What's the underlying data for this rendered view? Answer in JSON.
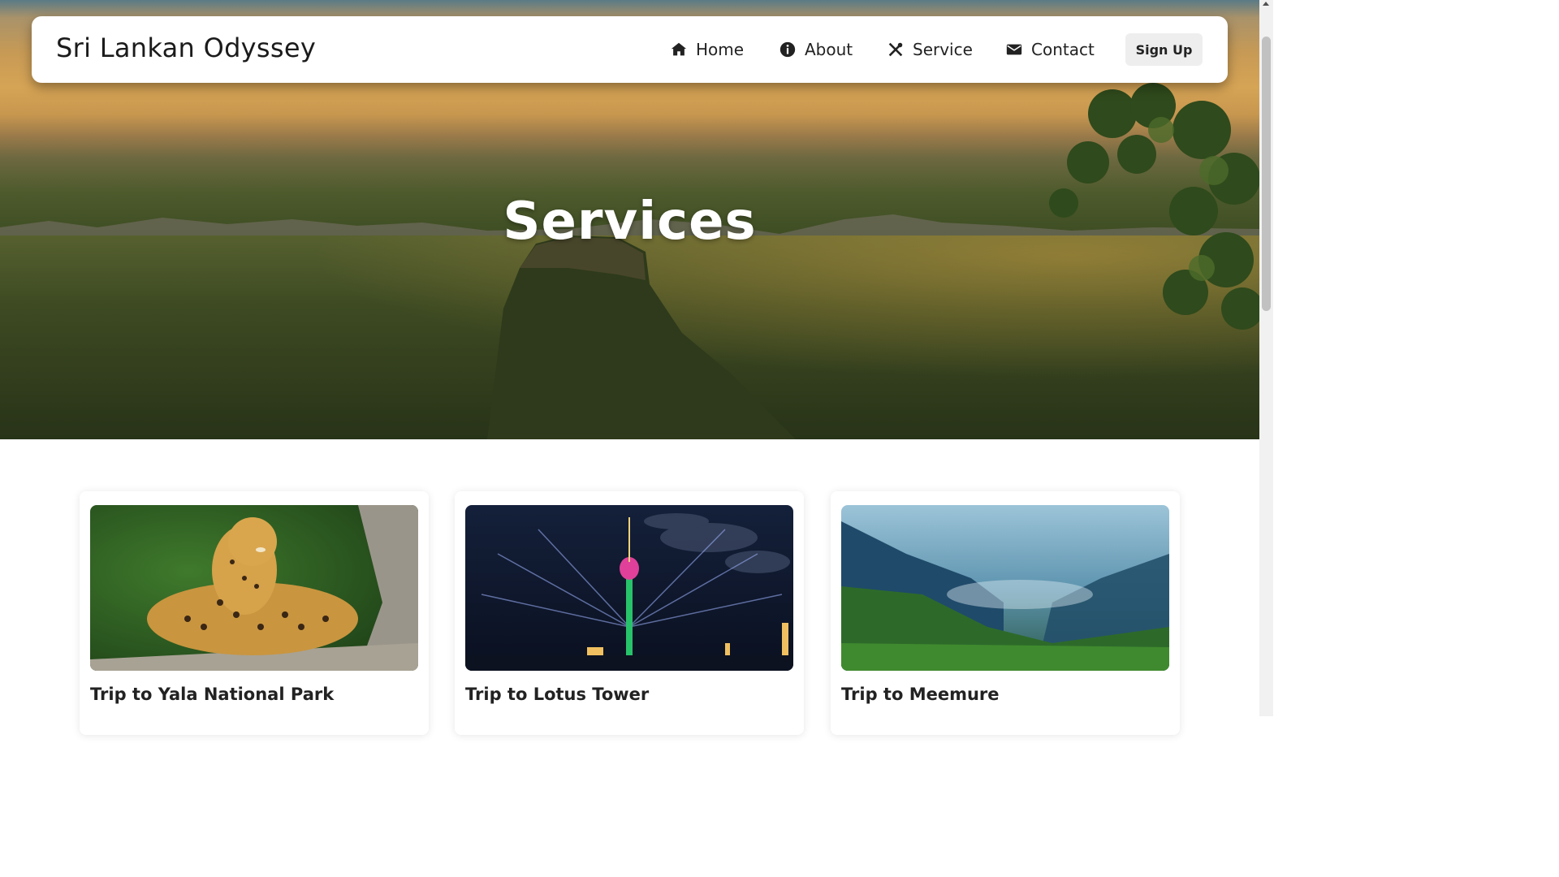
{
  "brand": {
    "name": "Sri Lankan Odyssey"
  },
  "nav": {
    "items": [
      {
        "label": "Home",
        "icon": "home-icon"
      },
      {
        "label": "About",
        "icon": "info-icon"
      },
      {
        "label": "Service",
        "icon": "tools-icon"
      },
      {
        "label": "Contact",
        "icon": "envelope-icon"
      }
    ],
    "signup_label": "Sign Up"
  },
  "hero": {
    "title": "Services"
  },
  "cards": [
    {
      "title": "Trip to Yala National Park",
      "image": "leopard-photo"
    },
    {
      "title": "Trip to Lotus Tower",
      "image": "lotus-tower-night-photo"
    },
    {
      "title": "Trip to Meemure",
      "image": "misty-mountains-photo"
    }
  ],
  "colors": {
    "navbar_bg": "#ffffff",
    "signup_bg": "#eeeeee",
    "hero_text": "#ffffff"
  }
}
